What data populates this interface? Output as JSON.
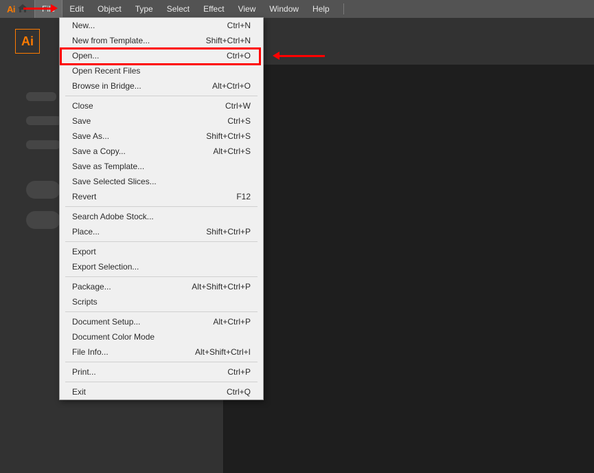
{
  "app_logo_text": "Ai",
  "menubar_home": "Ai",
  "menubar": [
    "File",
    "Edit",
    "Object",
    "Type",
    "Select",
    "Effect",
    "View",
    "Window",
    "Help"
  ],
  "menubar_active_index": 0,
  "file_menu": {
    "groups": [
      [
        {
          "label": "New...",
          "shortcut": "Ctrl+N"
        },
        {
          "label": "New from Template...",
          "shortcut": "Shift+Ctrl+N"
        },
        {
          "label": "Open...",
          "shortcut": "Ctrl+O"
        },
        {
          "label": "Open Recent Files",
          "submenu": true
        },
        {
          "label": "Browse in Bridge...",
          "shortcut": "Alt+Ctrl+O"
        }
      ],
      [
        {
          "label": "Close",
          "shortcut": "Ctrl+W"
        },
        {
          "label": "Save",
          "shortcut": "Ctrl+S"
        },
        {
          "label": "Save As...",
          "shortcut": "Shift+Ctrl+S"
        },
        {
          "label": "Save a Copy...",
          "shortcut": "Alt+Ctrl+S"
        },
        {
          "label": "Save as Template..."
        },
        {
          "label": "Save Selected Slices..."
        },
        {
          "label": "Revert",
          "shortcut": "F12"
        }
      ],
      [
        {
          "label": "Search Adobe Stock..."
        },
        {
          "label": "Place...",
          "shortcut": "Shift+Ctrl+P"
        }
      ],
      [
        {
          "label": "Export",
          "submenu": true
        },
        {
          "label": "Export Selection..."
        }
      ],
      [
        {
          "label": "Package...",
          "shortcut": "Alt+Shift+Ctrl+P"
        },
        {
          "label": "Scripts",
          "submenu": true
        }
      ],
      [
        {
          "label": "Document Setup...",
          "shortcut": "Alt+Ctrl+P"
        },
        {
          "label": "Document Color Mode",
          "submenu": true
        },
        {
          "label": "File Info...",
          "shortcut": "Alt+Shift+Ctrl+I"
        }
      ],
      [
        {
          "label": "Print...",
          "shortcut": "Ctrl+P"
        }
      ],
      [
        {
          "label": "Exit",
          "shortcut": "Ctrl+Q"
        }
      ]
    ]
  },
  "annotations": {
    "highlighted_item": "Open...",
    "arrow1_points_to": "File",
    "arrow2_points_to": "Open..."
  }
}
